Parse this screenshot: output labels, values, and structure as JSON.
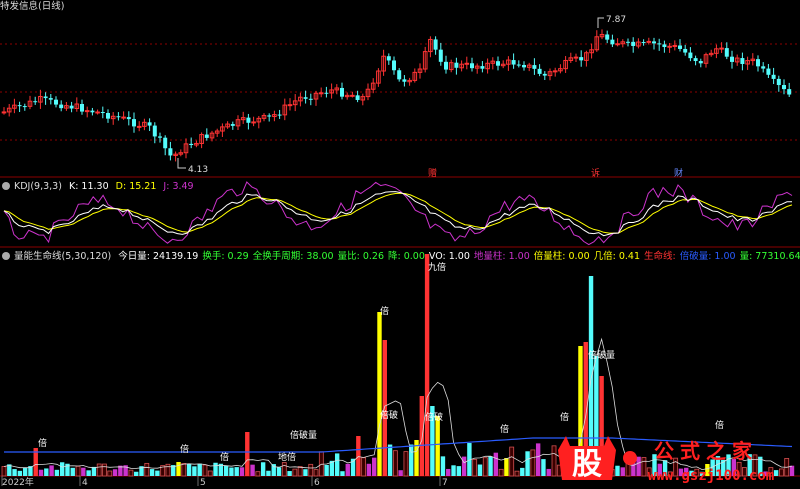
{
  "colors": {
    "up": "#ff3333",
    "down": "#54fcfc",
    "k": "#ffffff",
    "d": "#ffff00",
    "j": "#cc33cc",
    "grid": "#8b0000",
    "lifeline": "#2a5cff"
  },
  "price_panel": {
    "title": "特发信息(日线)",
    "high_label": "7.87",
    "low_label": "4.13",
    "event_marks": [
      "赠",
      "诉",
      "财"
    ],
    "event_colors": [
      "#ff3333",
      "#ff3333",
      "#6688ff"
    ]
  },
  "kdj_panel": {
    "name": "KDJ(9,3,3)",
    "k": "K: 11.30",
    "d": "D: 15.21",
    "j": "J: 3.49"
  },
  "volume_panel": {
    "name": "量能生命线(5,30,120)",
    "items": [
      {
        "text": "今日量: 24139.19",
        "color": "#ffffff"
      },
      {
        "text": "换手: 0.29",
        "color": "#33ff33"
      },
      {
        "text": "全换手周期: 38.00",
        "color": "#33ff33"
      },
      {
        "text": "量比: 0.26",
        "color": "#33ff33"
      },
      {
        "text": "降: 0.00",
        "color": "#33ff33"
      },
      {
        "text": "VO: 1.00",
        "color": "#ffffff"
      },
      {
        "text": "地量柱: 1.00",
        "color": "#cc33cc"
      },
      {
        "text": "倍量柱: 0.00",
        "color": "#ffff00"
      },
      {
        "text": "几倍: 0.41",
        "color": "#ffff00"
      },
      {
        "text": "生命线:",
        "color": "#ff3333"
      },
      {
        "text": "倍破量: 1.00",
        "color": "#2a5cff"
      },
      {
        "text": "量: 77310.64",
        "color": "#33ff33"
      }
    ],
    "bar_labels": {
      "bei": "倍",
      "beipo": "倍破量",
      "beipo_short": "倍破",
      "dibei": "地倍",
      "jiubei": "九倍"
    }
  },
  "x_axis": [
    "2022年",
    "4",
    "5",
    "6",
    "7"
  ],
  "logo": {
    "text": "公式之家",
    "url": "www.gszj100.com",
    "glyph": "股"
  }
}
